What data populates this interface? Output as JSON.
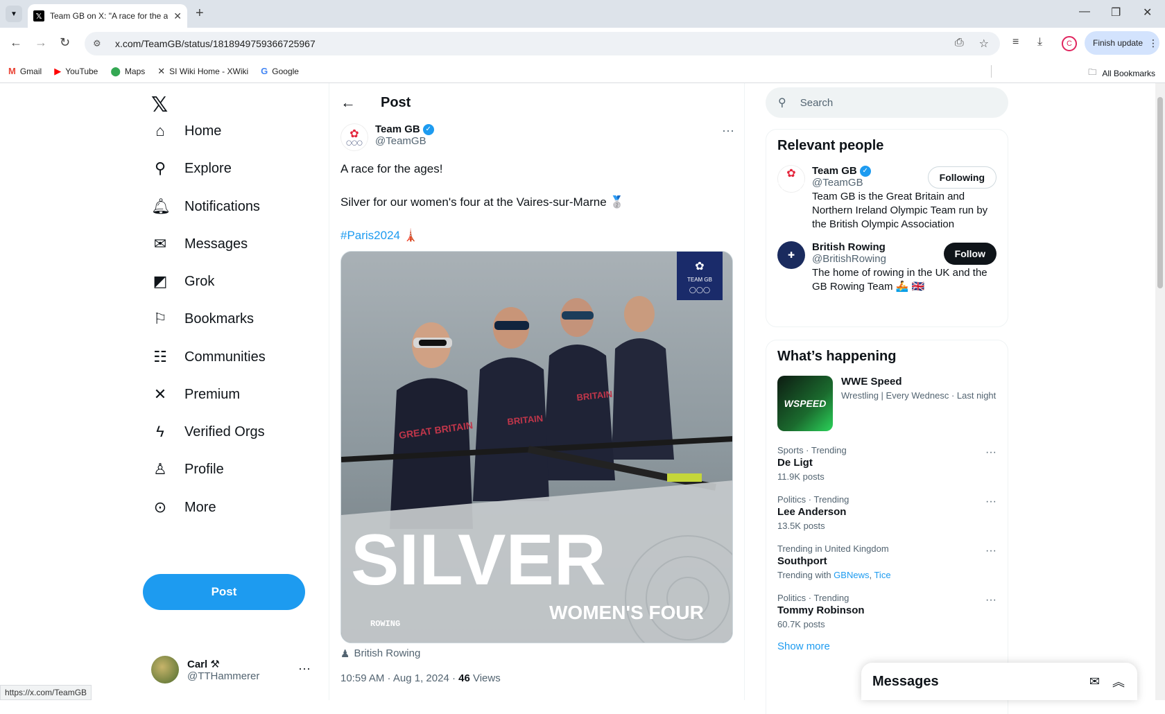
{
  "browser": {
    "tab_title": "Team GB on X: \"A race for the a",
    "url": "x.com/TeamGB/status/1818949759366725967",
    "finish_update": "Finish update",
    "profile_initial": "C",
    "status_url": "https://x.com/TeamGB",
    "bookmarks": [
      {
        "label": "Gmail",
        "icon": "gmail-icon",
        "glyph": "M",
        "color": "#ea4335"
      },
      {
        "label": "YouTube",
        "icon": "youtube-icon",
        "glyph": "▶",
        "color": "#ff0000"
      },
      {
        "label": "Maps",
        "icon": "maps-icon",
        "glyph": "⬤",
        "color": "#34a853"
      },
      {
        "label": "SI Wiki Home - XWiki",
        "icon": "xwiki-icon",
        "glyph": "✕",
        "color": "#333333"
      },
      {
        "label": "Google",
        "icon": "google-icon",
        "glyph": "G",
        "color": "#4285f4"
      }
    ],
    "all_bookmarks": "All Bookmarks"
  },
  "nav": {
    "items": [
      {
        "label": "Home",
        "icon": "home-icon",
        "glyph": "⌂"
      },
      {
        "label": "Explore",
        "icon": "search-icon",
        "glyph": "⚲"
      },
      {
        "label": "Notifications",
        "icon": "bell-icon",
        "glyph": "♫"
      },
      {
        "label": "Messages",
        "icon": "mail-icon",
        "glyph": "✉"
      },
      {
        "label": "Grok",
        "icon": "grok-icon",
        "glyph": "◩"
      },
      {
        "label": "Bookmarks",
        "icon": "bookmark-icon",
        "glyph": "⚐"
      },
      {
        "label": "Communities",
        "icon": "communities-icon",
        "glyph": "☷"
      },
      {
        "label": "Premium",
        "icon": "x-icon",
        "glyph": "✕"
      },
      {
        "label": "Verified Orgs",
        "icon": "lightning-icon",
        "glyph": "ϟ"
      },
      {
        "label": "Profile",
        "icon": "person-icon",
        "glyph": "♙"
      },
      {
        "label": "More",
        "icon": "more-circle-icon",
        "glyph": "⋯"
      }
    ],
    "post_button": "Post",
    "account": {
      "name": "Carl ⚒",
      "handle": "@TTHammerer"
    }
  },
  "post": {
    "header_title": "Post",
    "author_name": "Team GB",
    "author_handle": "@TeamGB",
    "text_line1": "A race for the ages!",
    "text_line2": "Silver for our women's four at the Vaires-sur-Marne 🥈",
    "hashtag": "#Paris2024",
    "hashtag_emoji": "🗼",
    "image_big_text": "SILVER",
    "image_sub_text": "WOMEN'S FOUR",
    "image_corner_text": "ROWING",
    "image_badge": "TEAM GB",
    "credit": "British Rowing",
    "time": "10:59 AM · Aug 1, 2024 · ",
    "views_count": "46",
    "views_label": " Views"
  },
  "sidebar": {
    "search_placeholder": "Search",
    "relevant_title": "Relevant people",
    "people": [
      {
        "name": "Team GB",
        "handle": "@TeamGB",
        "verified": true,
        "bio": "Team GB is the Great Britain and Northern Ireland Olympic Team run by the British Olympic Association",
        "button": "Following"
      },
      {
        "name": "British Rowing",
        "handle": "@BritishRowing",
        "verified": false,
        "bio": "The home of rowing in the UK and the GB Rowing Team 🚣 🇬🇧",
        "button": "Follow"
      }
    ],
    "happening_title": "What’s happening",
    "wwe": {
      "title": "WWE Speed",
      "sub": "Wrestling | Every Wednesc · Last night",
      "thumb": "WSPEED"
    },
    "trends": [
      {
        "category": "Sports · Trending",
        "name": "De Ligt",
        "count": "11.9K posts"
      },
      {
        "category": "Politics · Trending",
        "name": "Lee Anderson",
        "count": "13.5K posts"
      },
      {
        "category": "Trending in United Kingdom",
        "name": "Southport",
        "count_prefix": "Trending with ",
        "link1": "GBNews",
        "link2": "Tice"
      },
      {
        "category": "Politics · Trending",
        "name": "Tommy Robinson",
        "count": "60.7K posts"
      }
    ],
    "show_more": "Show more",
    "messages_title": "Messages"
  },
  "colors": {
    "accent": "#1d9bf0",
    "text": "#0f1419",
    "muted": "#536471"
  }
}
